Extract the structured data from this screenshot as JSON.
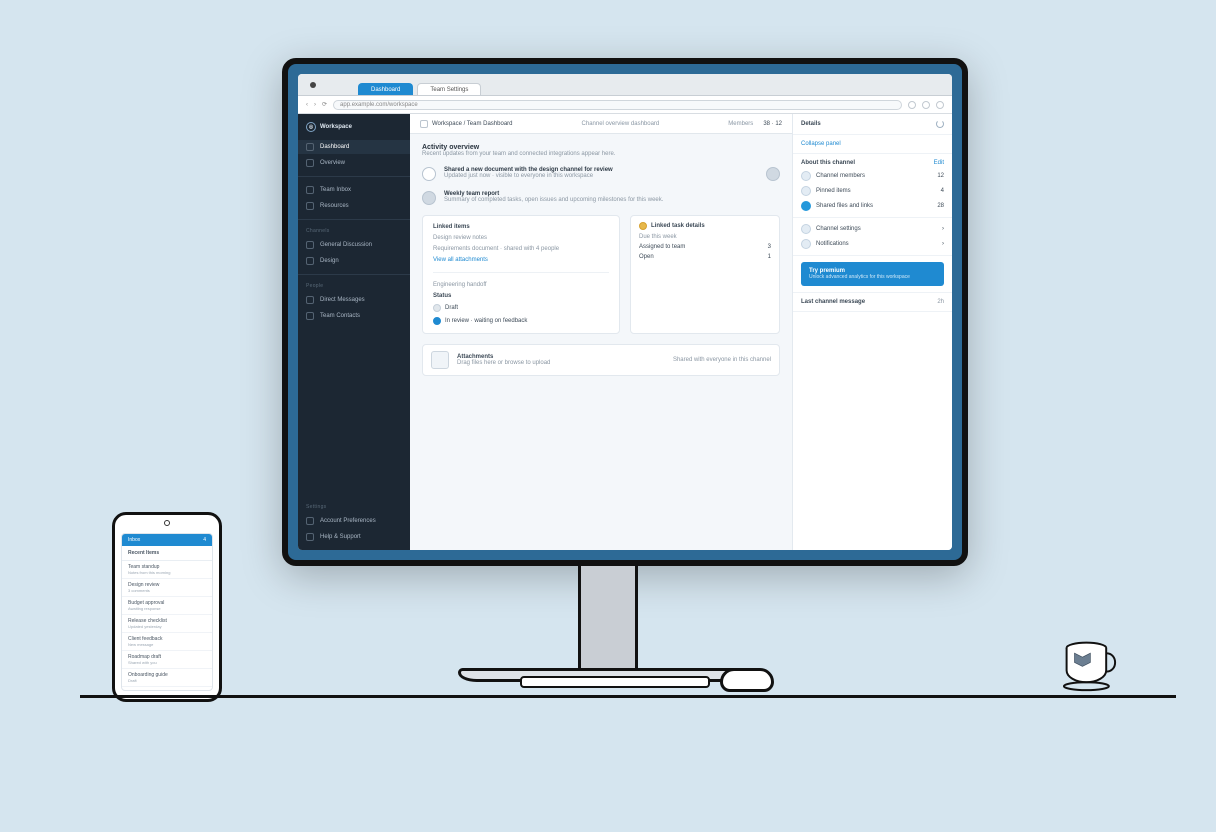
{
  "browser": {
    "tabs": [
      {
        "label": "Dashboard",
        "active": true
      },
      {
        "label": "Team Settings",
        "active": false
      }
    ],
    "url": "app.example.com/workspace"
  },
  "sidebar": {
    "brand": "Workspace",
    "items": [
      {
        "label": "Dashboard"
      },
      {
        "label": "Overview"
      }
    ],
    "items2": [
      {
        "label": "Team Inbox"
      },
      {
        "label": "Resources"
      }
    ],
    "group1": "Channels",
    "items3": [
      {
        "label": "General Discussion"
      },
      {
        "label": "Design"
      }
    ],
    "group2": "People",
    "items4": [
      {
        "label": "Direct Messages"
      },
      {
        "label": "Team Contacts"
      }
    ],
    "footer_group": "Settings",
    "footer_items": [
      {
        "label": "Account Preferences"
      },
      {
        "label": "Help & Support"
      }
    ]
  },
  "toolbar": {
    "crumb": "Workspace / Team Dashboard",
    "center": "Channel overview dashboard",
    "right_label": "Members",
    "right_meta": "38 · 12"
  },
  "content": {
    "section_title": "Activity overview",
    "section_sub": "Recent updates from your team and connected integrations appear here.",
    "feed": [
      {
        "title": "Shared a new document with the design channel for review",
        "desc": "Updated just now · visible to everyone in this workspace"
      },
      {
        "title": "Weekly team report",
        "desc": "Summary of completed tasks, open issues and upcoming milestones for this week."
      }
    ],
    "card": {
      "heading": "Linked items",
      "rows": [
        {
          "label": "Design review notes",
          "meta": ""
        },
        {
          "label": "Requirements document · shared with 4 people",
          "meta": ""
        },
        {
          "label": "Engineering handoff",
          "meta": ""
        }
      ],
      "link1": "View all attachments",
      "status_label": "Status",
      "status_items": [
        {
          "label": "Draft",
          "kind": "plain"
        },
        {
          "label": "In review · waiting on feedback",
          "kind": "blue"
        }
      ]
    },
    "side_card": {
      "title": "Linked task details",
      "sub": "Due this week",
      "row1": "Assigned to team",
      "row1_meta": "3",
      "row2": "Open",
      "row2_meta": "1"
    },
    "footer": {
      "title": "Attachments",
      "sub": "Drag files here or browse to upload",
      "right": "Shared with everyone in this channel"
    }
  },
  "rightpanel": {
    "head": "Details",
    "sub_link": "Collapse panel",
    "section1_title": "About this channel",
    "section1_meta": "Edit",
    "rows1": [
      {
        "label": "Channel members",
        "meta": "12"
      },
      {
        "label": "Pinned items",
        "meta": "4"
      },
      {
        "label": "Shared files and links",
        "meta": "28"
      }
    ],
    "rows2": [
      {
        "label": "Channel settings",
        "meta": "›"
      },
      {
        "label": "Notifications",
        "meta": "›"
      }
    ],
    "cta_title": "Try premium",
    "cta_sub": "Unlock advanced analytics for this workspace",
    "last_title": "Last channel message",
    "last_meta": "2h"
  },
  "phone": {
    "header_left": "Inbox",
    "header_right": "4",
    "title": "Recent Items",
    "items": [
      {
        "t": "Team standup",
        "s": "Notes from this morning"
      },
      {
        "t": "Design review",
        "s": "3 comments"
      },
      {
        "t": "Budget approval",
        "s": "Awaiting response"
      },
      {
        "t": "Release checklist",
        "s": "Updated yesterday"
      },
      {
        "t": "Client feedback",
        "s": "New message"
      },
      {
        "t": "Roadmap draft",
        "s": "Shared with you"
      },
      {
        "t": "Onboarding guide",
        "s": "Draft"
      }
    ]
  }
}
